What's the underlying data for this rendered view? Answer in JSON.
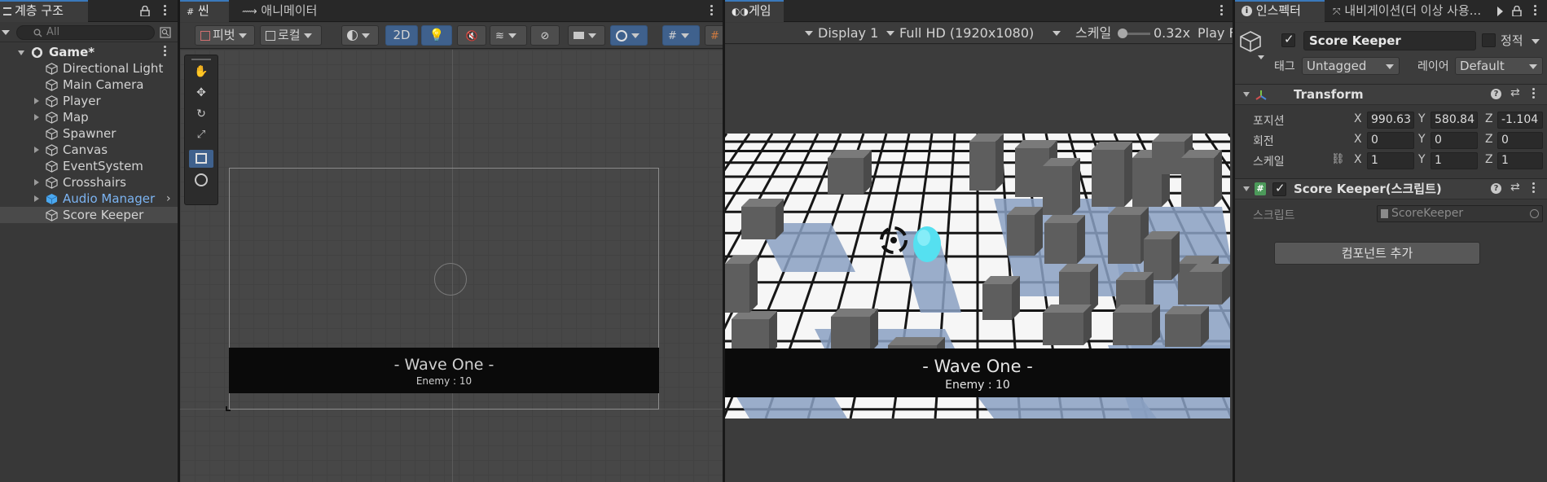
{
  "hierarchy": {
    "tab_label": "계층 구조",
    "search_placeholder": "All",
    "scene_root": "Game*",
    "items": [
      {
        "label": "Directional Light"
      },
      {
        "label": "Main Camera"
      },
      {
        "label": "Player"
      },
      {
        "label": "Map"
      },
      {
        "label": "Spawner"
      },
      {
        "label": "Canvas"
      },
      {
        "label": "EventSystem"
      },
      {
        "label": "Crosshairs"
      },
      {
        "label": "Audio Manager"
      },
      {
        "label": "Score Keeper"
      }
    ]
  },
  "scene": {
    "tab_scene": "씬",
    "tab_animator": "애니메이터",
    "pivot_label": "피벗",
    "local_label": "로컬",
    "mode_2d": "2D",
    "wave_title": "- Wave One -",
    "wave_sub": "Enemy : 10"
  },
  "game": {
    "tab_label": "게임",
    "display": "Display 1",
    "resolution": "Full HD (1920x1080)",
    "scale_label": "스케일",
    "scale_value": "0.32x",
    "play_label": "Play F",
    "wave_title": "- Wave One -",
    "wave_sub": "Enemy : 10"
  },
  "inspector": {
    "tab_inspector": "인스펙터",
    "tab_navigation": "내비게이션(더 이상 사용...",
    "object_name": "Score Keeper",
    "static_label": "정적",
    "tag_label": "태그",
    "tag_value": "Untagged",
    "layer_label": "레이어",
    "layer_value": "Default",
    "transform": {
      "title": "Transform",
      "position_label": "포지션",
      "rotation_label": "회전",
      "scale_label": "스케일",
      "axis_x": "X",
      "axis_y": "Y",
      "axis_z": "Z",
      "position": {
        "x": "990.63",
        "y": "580.84",
        "z": "-1.104"
      },
      "rotation": {
        "x": "0",
        "y": "0",
        "z": "0"
      },
      "scale": {
        "x": "1",
        "y": "1",
        "z": "1"
      }
    },
    "script_component": {
      "title": "Score Keeper(스크립트)",
      "script_label": "스크립트",
      "script_value": "ScoreKeeper"
    },
    "add_component": "컴포넌트 추가"
  },
  "colors": {
    "selection": "#3f618d",
    "audio_manager_text": "#7cb4f2",
    "cyan_ball": "#55e0f0"
  }
}
